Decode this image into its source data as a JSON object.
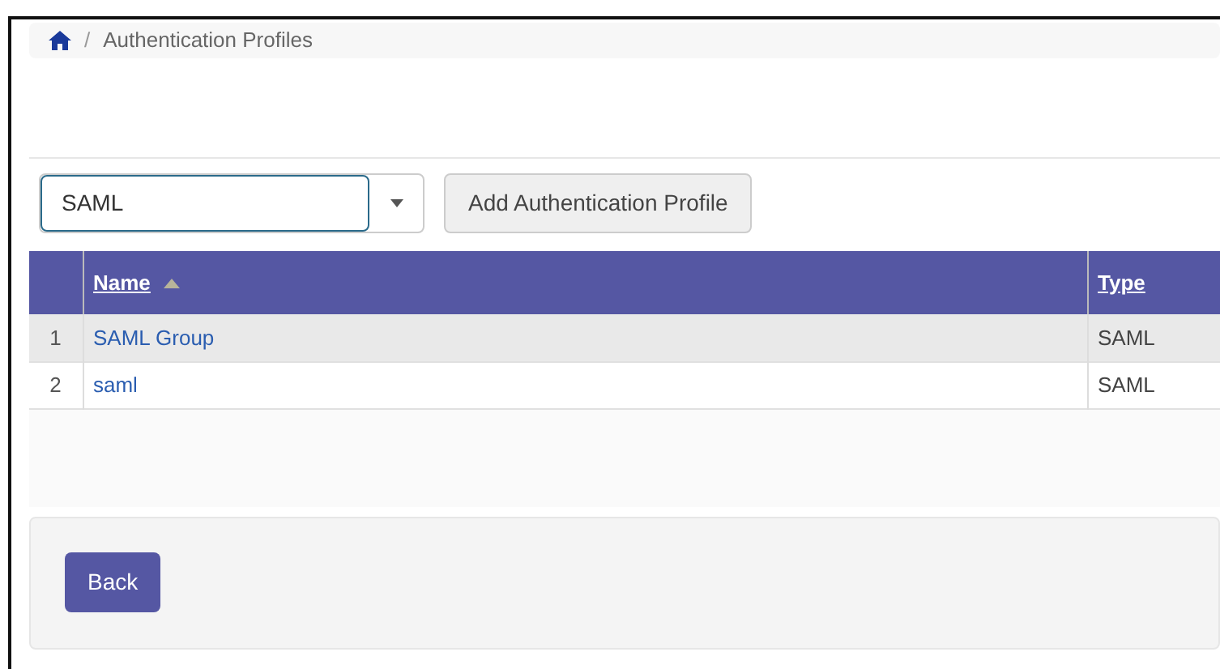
{
  "breadcrumb": {
    "separator": "/",
    "current": "Authentication Profiles"
  },
  "filter": {
    "value": "SAML"
  },
  "add_button": "Add Authentication Profile",
  "table": {
    "columns": [
      "Name",
      "Type"
    ],
    "rows": [
      {
        "number": "1",
        "name": "SAML Group",
        "type": "SAML"
      },
      {
        "number": "2",
        "name": "saml",
        "type": "SAML"
      }
    ]
  },
  "back_button": "Back"
}
